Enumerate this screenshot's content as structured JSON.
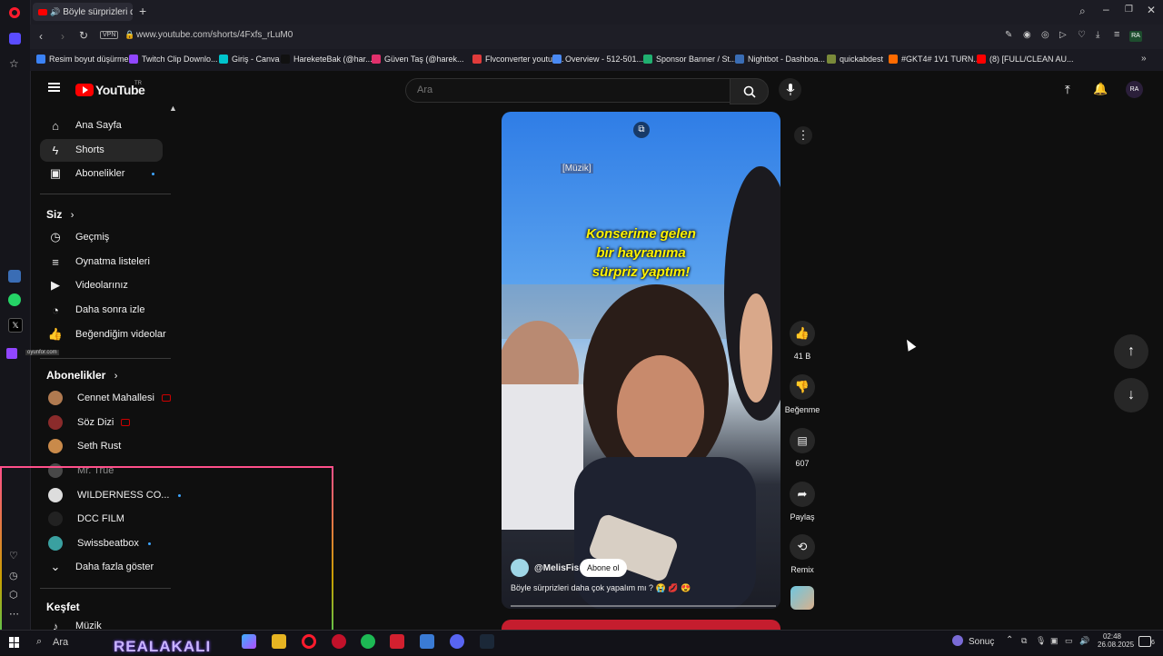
{
  "browser": {
    "tab_title": "Böyle sürprizleri daha",
    "url": "www.youtube.com/shorts/4Fxfs_rLuM0",
    "vpn_badge": "VPN",
    "bookmarks": [
      {
        "label": "Resim boyut düşürme",
        "color": "#3b82f6"
      },
      {
        "label": "Twitch Clip Downlo...",
        "color": "#9146ff"
      },
      {
        "label": "Giriş - Canva",
        "color": "#00c4cc"
      },
      {
        "label": "HareketeBak (@har...",
        "color": "#111111"
      },
      {
        "label": "Güven Taş (@harek...",
        "color": "#e1306c"
      },
      {
        "label": "Flvconverter youtub...",
        "color": "#e03b3b"
      },
      {
        "label": "Overview - 512-501...",
        "color": "#4a8af4"
      },
      {
        "label": "Sponsor Banner / St...",
        "color": "#20b070"
      },
      {
        "label": "Nightbot - Dashboa...",
        "color": "#3a6db5"
      },
      {
        "label": "quickabdest",
        "color": "#7a8a3a"
      },
      {
        "label": "#GKT4# 1V1 TURN...",
        "color": "#ff6b00"
      },
      {
        "label": "(8) [FULL/CLEAN AU...",
        "color": "#ff0000"
      }
    ]
  },
  "youtube": {
    "logo": "YouTube",
    "region": "TR",
    "search_placeholder": "Ara",
    "sidebar": {
      "main": [
        {
          "label": "Ana Sayfa",
          "icon": "home-icon"
        },
        {
          "label": "Shorts",
          "icon": "shorts-icon"
        },
        {
          "label": "Abonelikler",
          "icon": "subscriptions-icon"
        }
      ],
      "you_title": "Siz",
      "you": [
        {
          "label": "Geçmiş",
          "icon": "history-icon"
        },
        {
          "label": "Oynatma listeleri",
          "icon": "playlist-icon"
        },
        {
          "label": "Videolarınız",
          "icon": "your-videos-icon"
        },
        {
          "label": "Daha sonra izle",
          "icon": "watch-later-icon"
        },
        {
          "label": "Beğendiğim videolar",
          "icon": "liked-videos-icon"
        }
      ],
      "subs_title": "Abonelikler",
      "subs": [
        {
          "label": "Cennet Mahallesi",
          "color": "#b07a50"
        },
        {
          "label": "Söz Dizi",
          "color": "#8a2b2b"
        },
        {
          "label": "Seth Rust",
          "color": "#c98a4a"
        },
        {
          "label": "Mr. True",
          "color": "#777777"
        },
        {
          "label": "WILDERNESS CO...",
          "color": "#dddddd"
        },
        {
          "label": "DCC FILM",
          "color": "#222222"
        },
        {
          "label": "Swissbeatbox",
          "color": "#3aa0a0"
        }
      ],
      "show_more": "Daha fazla göster",
      "explore_title": "Keşfet",
      "explore": [
        {
          "label": "Müzik"
        }
      ]
    },
    "short": {
      "caption_tag": "[Müzik]",
      "overlay_text": [
        "Konserime gelen",
        "bir hayranıma",
        "sürpriz yaptım!"
      ],
      "channel": "@MelisFis",
      "subscribe": "Abone ol",
      "title": "Böyle sürprizleri daha çok yapalım mı ? 😭 💋 😍",
      "actions": {
        "likes": "41 B",
        "dislike": "Beğenme",
        "comments": "607",
        "share": "Paylaş",
        "remix": "Remix"
      }
    }
  },
  "taskbar": {
    "search": "Ara",
    "weather": "Sonuç",
    "time": "02:48",
    "date": "26.08.2025",
    "notification_count": "6",
    "stream_watermark": "REALAKALI"
  },
  "opera": {
    "side_label": "oyunfor.com"
  }
}
